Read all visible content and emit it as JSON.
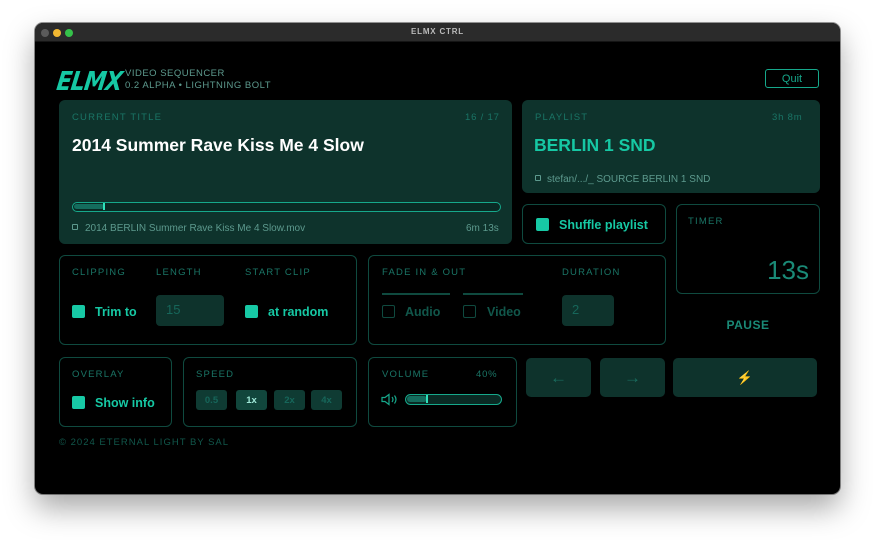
{
  "window": {
    "title": "ELMX CTRL"
  },
  "header": {
    "logo": "ELMX",
    "subtitle": "VIDEO SEQUENCER",
    "version": "0.2 ALPHA • LIGHTNING BOLT",
    "quit_label": "Quit"
  },
  "current_title": {
    "label": "CURRENT TITLE",
    "position": "16 / 17",
    "name": "2014 Summer Rave Kiss Me 4 Slow",
    "filename": "2014 BERLIN Summer Rave Kiss Me 4 Slow.mov",
    "duration": "6m 13s",
    "progress": 0.07
  },
  "playlist": {
    "label": "PLAYLIST",
    "total": "3h 8m",
    "name": "BERLIN 1 SND",
    "path": "stefan/.../_ SOURCE BERLIN 1 SND"
  },
  "shuffle": {
    "label": "Shuffle playlist",
    "checked": true
  },
  "timer": {
    "label": "TIMER",
    "value": "13s"
  },
  "clipping": {
    "label": "CLIPPING",
    "length_label": "LENGTH",
    "start_label": "START CLIP",
    "trim_label": "Trim to",
    "length_value": "15",
    "random_label": "at random"
  },
  "fade": {
    "label": "FADE IN & OUT",
    "duration_label": "DURATION",
    "audio_label": "Audio",
    "video_label": "Video",
    "duration_value": "2"
  },
  "pause_label": "PAUSE",
  "overlay": {
    "label": "OVERLAY",
    "show_info": "Show info"
  },
  "speed": {
    "label": "SPEED",
    "options": [
      "0.5",
      "1x",
      "2x",
      "4x"
    ],
    "selected": "1x"
  },
  "volume": {
    "label": "VOLUME",
    "percent": "40%",
    "level": 0.22
  },
  "nav": {
    "prev": "←",
    "next": "→",
    "bolt": "⚡"
  },
  "footer": {
    "copyright": "© 2024 ETERNAL LIGHT BY SAL"
  },
  "colors": {
    "accent": "#16c8a4",
    "panel": "#0e332c",
    "border": "#0f4a3f"
  }
}
